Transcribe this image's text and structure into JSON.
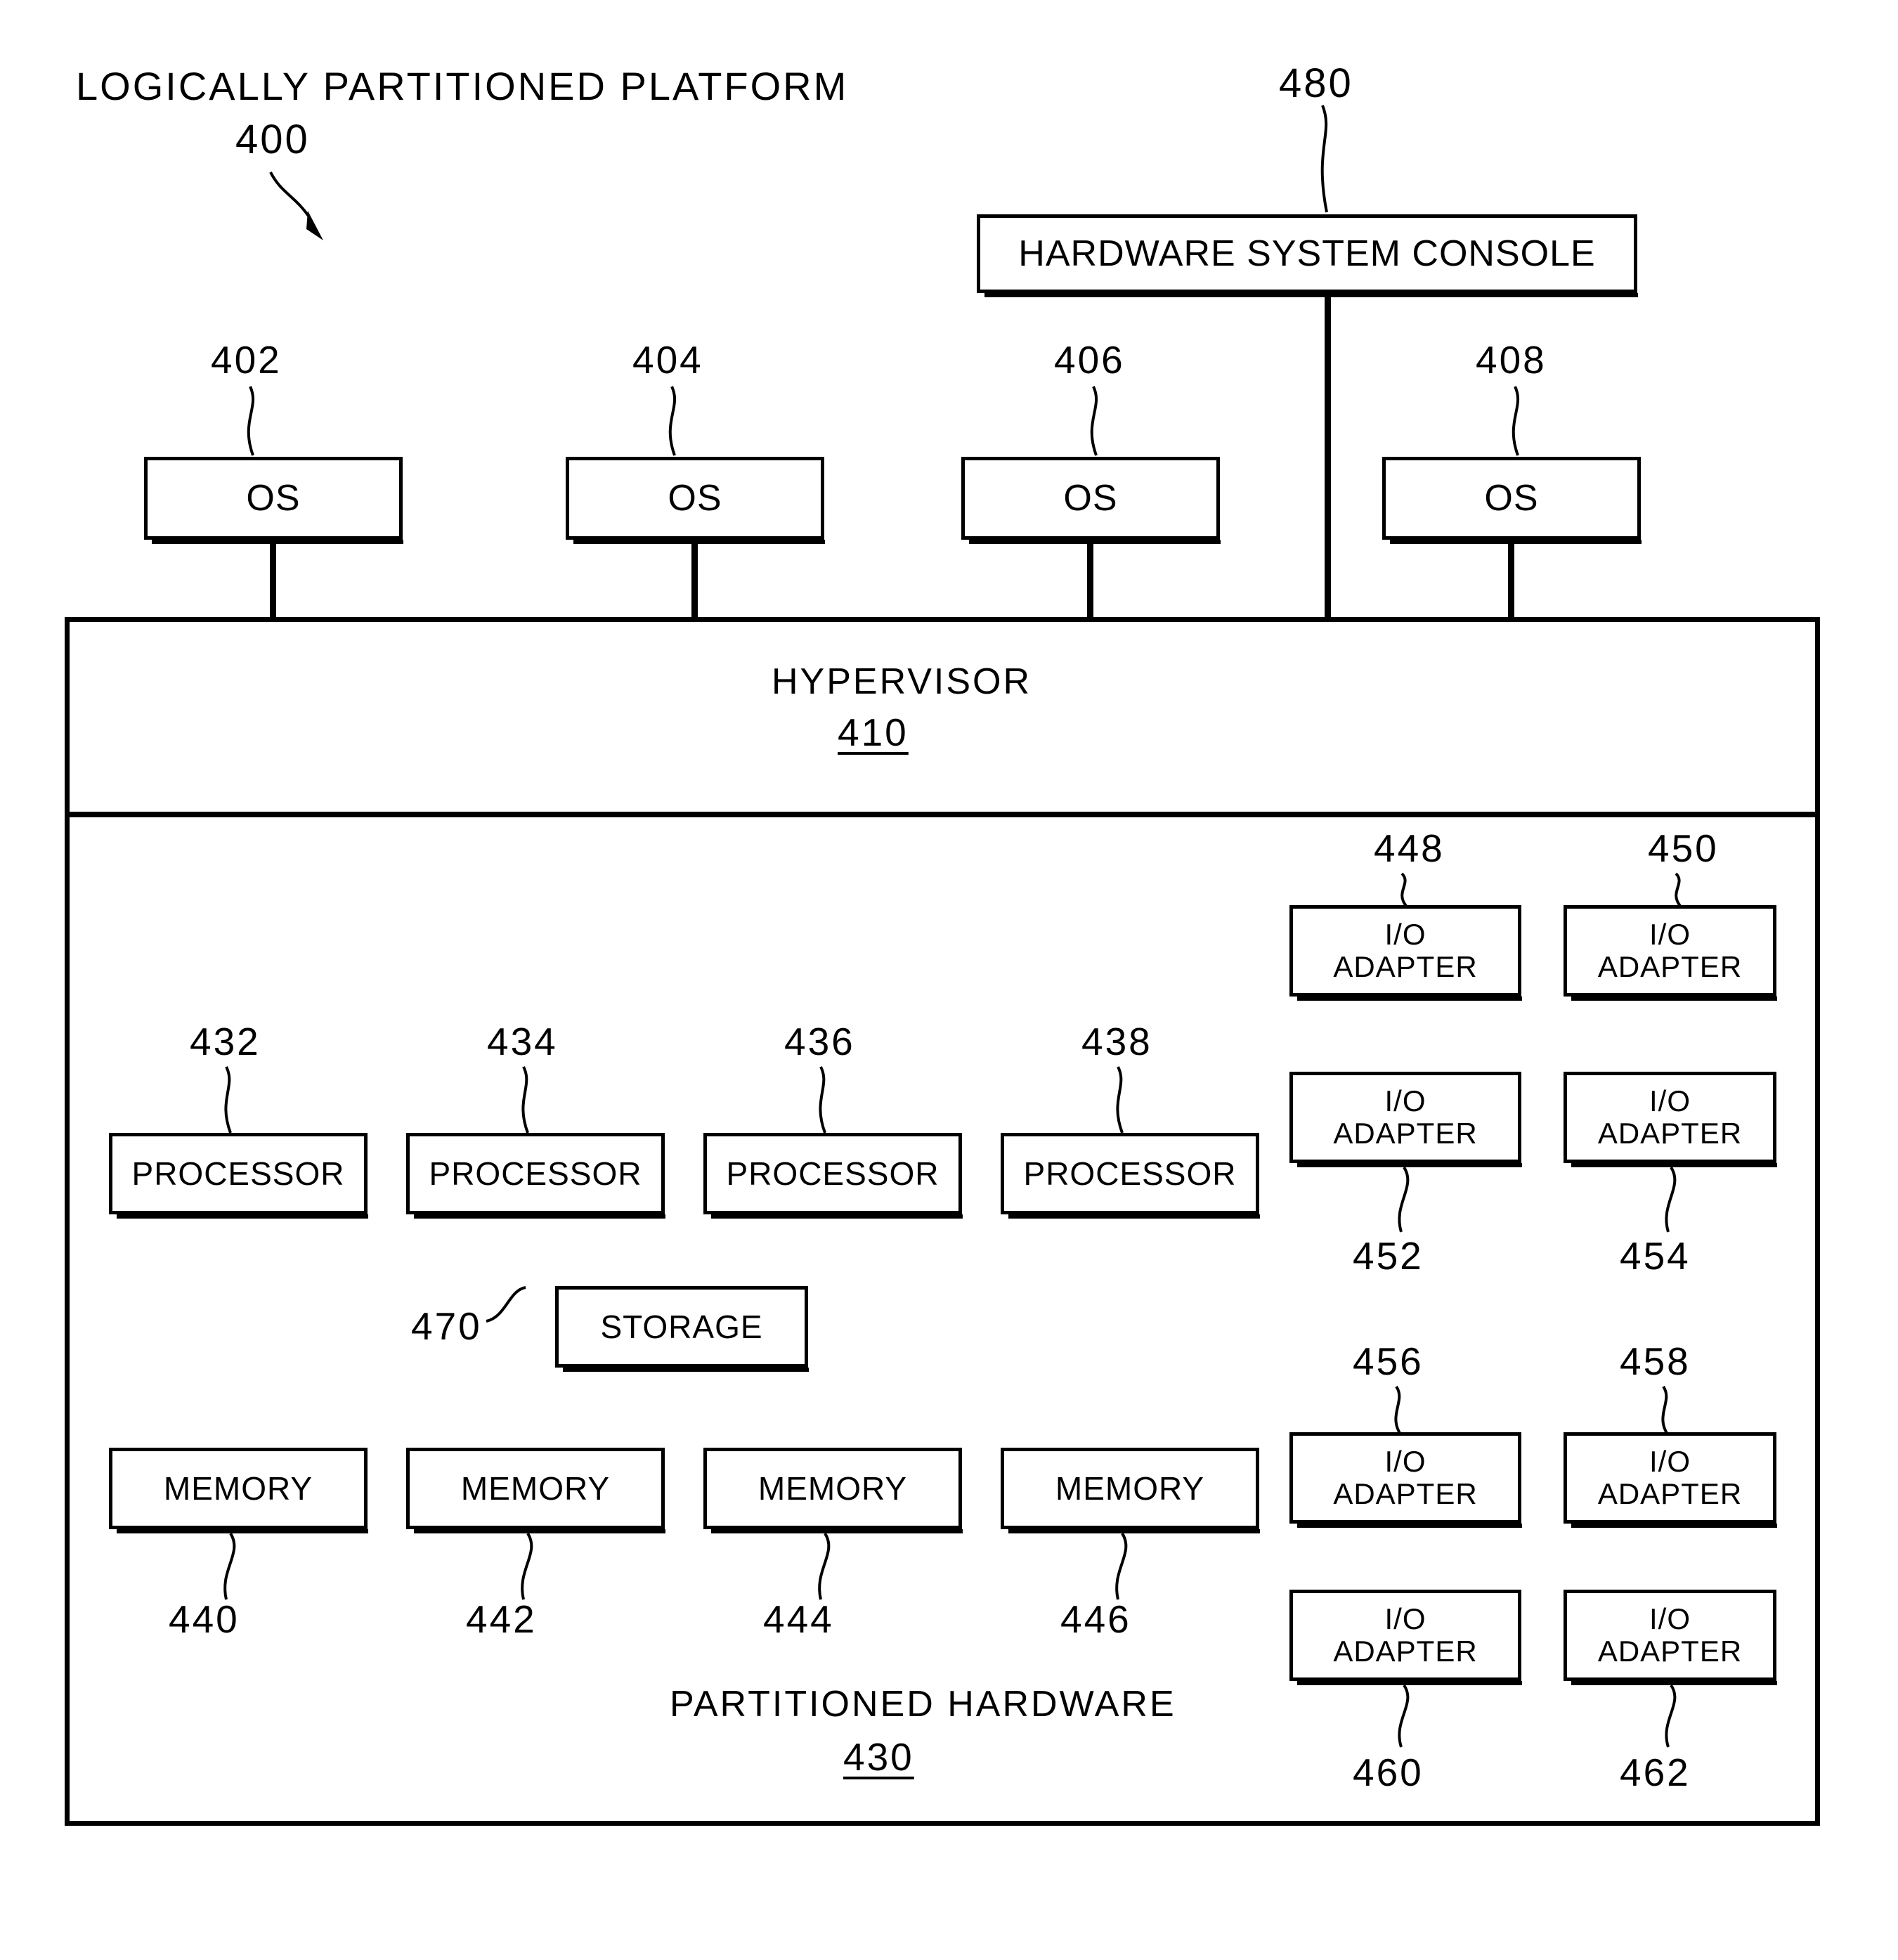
{
  "figure": {
    "title": "LOGICALLY PARTITIONED PLATFORM",
    "title_ref": "400"
  },
  "console": {
    "label": "HARDWARE SYSTEM CONSOLE",
    "ref": "480"
  },
  "operating_systems": [
    {
      "label": "OS",
      "ref": "402"
    },
    {
      "label": "OS",
      "ref": "404"
    },
    {
      "label": "OS",
      "ref": "406"
    },
    {
      "label": "OS",
      "ref": "408"
    }
  ],
  "hypervisor": {
    "label": "HYPERVISOR",
    "ref": "410"
  },
  "partitioned_hardware": {
    "label": "PARTITIONED  HARDWARE",
    "ref": "430"
  },
  "processors": [
    {
      "label": "PROCESSOR",
      "ref": "432"
    },
    {
      "label": "PROCESSOR",
      "ref": "434"
    },
    {
      "label": "PROCESSOR",
      "ref": "436"
    },
    {
      "label": "PROCESSOR",
      "ref": "438"
    }
  ],
  "memories": [
    {
      "label": "MEMORY",
      "ref": "440"
    },
    {
      "label": "MEMORY",
      "ref": "442"
    },
    {
      "label": "MEMORY",
      "ref": "444"
    },
    {
      "label": "MEMORY",
      "ref": "446"
    }
  ],
  "storage": {
    "label": "STORAGE",
    "ref": "470"
  },
  "io_adapters": [
    {
      "line1": "I/O",
      "line2": "ADAPTER",
      "ref": "448"
    },
    {
      "line1": "I/O",
      "line2": "ADAPTER",
      "ref": "450"
    },
    {
      "line1": "I/O",
      "line2": "ADAPTER",
      "ref": "452"
    },
    {
      "line1": "I/O",
      "line2": "ADAPTER",
      "ref": "454"
    },
    {
      "line1": "I/O",
      "line2": "ADAPTER",
      "ref": "456"
    },
    {
      "line1": "I/O",
      "line2": "ADAPTER",
      "ref": "458"
    },
    {
      "line1": "I/O",
      "line2": "ADAPTER",
      "ref": "460"
    },
    {
      "line1": "I/O",
      "line2": "ADAPTER",
      "ref": "462"
    }
  ],
  "colors": {
    "ink": "#000000",
    "paper": "#ffffff"
  }
}
